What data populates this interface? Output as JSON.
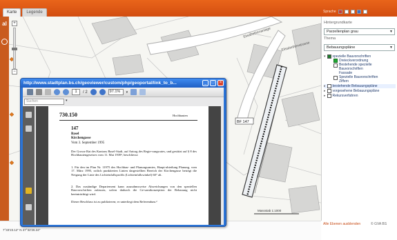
{
  "tabs": [
    {
      "label": "Karte"
    },
    {
      "label": "Legende"
    }
  ],
  "language": {
    "label": "Sprache"
  },
  "left": {
    "letter": "al"
  },
  "panel": {
    "background_title": "Hintergrundkarte",
    "background_value": "Parzellenplan grau",
    "theme_title": "Thema",
    "theme_value": "Bebauungspläne",
    "tree": {
      "item1": "spezielle Bauvorschriften",
      "sub1": "Dreieckverordnung",
      "sub2": "Bestehende spezielle Bauvorschriften",
      "sub3": "Fassade",
      "sub4": "Spezielle Bauvorschriften Ziffern",
      "item2": "bestehende Bebauungspläne",
      "item3": "vorgesehene Bebauungspläne",
      "item4": "Rekursverfahren"
    },
    "footer": "Alle Ebenen ausblenden",
    "footer_right": "© GVA BS"
  },
  "map": {
    "street1": "Elisabethenanlage",
    "street2": "Elisabethenstrasse",
    "house": "BF 147",
    "scale": "Massstab 1:1000",
    "coords": "7°33'23.12\"  N   47°32'26.34\""
  },
  "popup": {
    "title": "http://www.stadtplan.bs.ch/geoviewer/custom/php/geoportal/link_to_b...",
    "page_current": "1",
    "page_total": "/ 2",
    "zoom": "97.1%",
    "search_placeholder": "Suchen",
    "doc": {
      "number": "730.150",
      "header_right": "Hochbauten",
      "no": "147",
      "place": "Basel",
      "street": "Kirchengasse",
      "date": "Vom 3. September 1995",
      "p1": "Der Grosse Rat des Kantons Basel-Stadt, auf Antrag des Regie-rungsrates, und gestützt auf § 8 des Hochbautengesetzes vom 11. Mai 1939¹, beschliesst:",
      "p2": "1. Für den im Plan Nr. 11975 des Hochbau- und Planungsamtes, Haupt-abteilung Planung, vom 17. März 1995, rotlich punktierten Linien dargestellten Bereich der Kirchengasse beträgt die Neigung der Linie des Lichteinfallsprofils (Lichteinfallswinkel) 60° alt.",
      "p3": "2. Das zuständige Departement kann ausnahmsweise Abweichungen von den speziellen Bauvorschriften zulassen, sofern dadurch die Ge-samtkonzeption der Bebauung nicht beeinträchtigt wird.",
      "p4": "Dieser Beschluss ist zu publizieren; er unterliegt dem Referendum.²"
    }
  }
}
